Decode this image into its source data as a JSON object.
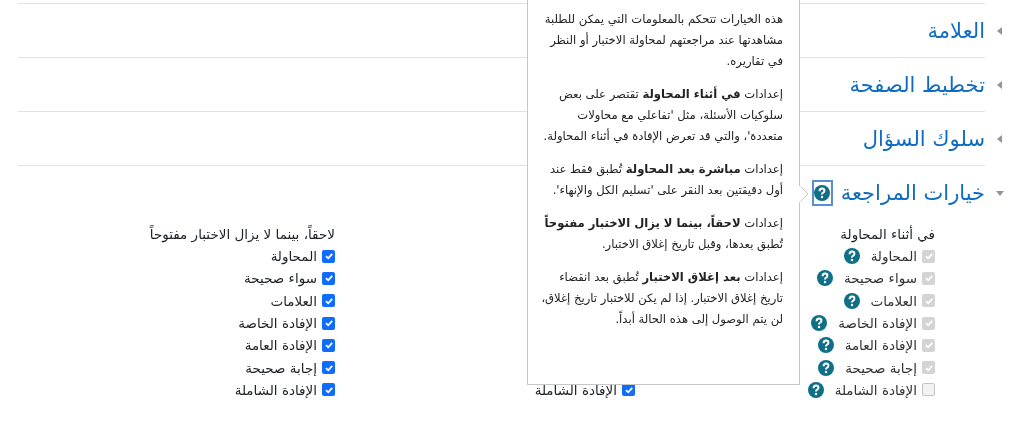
{
  "sections": [
    {
      "title": "العلامة",
      "expanded": false
    },
    {
      "title": "تخطيط الصفحة",
      "expanded": false
    },
    {
      "title": "سلوك السؤال",
      "expanded": false
    },
    {
      "title": "خيارات المراجعة",
      "expanded": true
    }
  ],
  "review_columns": [
    {
      "heading": "في أثناء المحاولة",
      "items": [
        {
          "label": "المحاولة",
          "checked": true,
          "disabled": true,
          "help": true
        },
        {
          "label": "سواء صحيحة",
          "checked": true,
          "disabled": true,
          "help": true
        },
        {
          "label": "العلامات",
          "checked": true,
          "disabled": true,
          "help": true
        },
        {
          "label": "الإفادة الخاصة",
          "checked": true,
          "disabled": true,
          "help": true
        },
        {
          "label": "الإفادة العامة",
          "checked": true,
          "disabled": true,
          "help": true
        },
        {
          "label": "إجابة صحيحة",
          "checked": true,
          "disabled": true,
          "help": true
        },
        {
          "label": "الإفادة الشاملة",
          "checked": false,
          "disabled": true,
          "help": true
        }
      ]
    },
    {
      "items": [
        {
          "label": "الإفادة الشاملة",
          "checked": true,
          "disabled": false,
          "help": false
        }
      ]
    },
    {
      "heading": "لاحقاً، بينما لا يزال الاختبار مفتوحاً",
      "items": [
        {
          "label": "المحاولة",
          "checked": true,
          "disabled": false,
          "help": false
        },
        {
          "label": "سواء صحيحة",
          "checked": true,
          "disabled": false,
          "help": false
        },
        {
          "label": "العلامات",
          "checked": true,
          "disabled": false,
          "help": false
        },
        {
          "label": "الإفادة الخاصة",
          "checked": true,
          "disabled": false,
          "help": false
        },
        {
          "label": "الإفادة العامة",
          "checked": true,
          "disabled": false,
          "help": false
        },
        {
          "label": "إجابة صحيحة",
          "checked": true,
          "disabled": false,
          "help": false
        },
        {
          "label": "الإفادة الشاملة",
          "checked": true,
          "disabled": false,
          "help": false
        }
      ]
    }
  ],
  "help_popover": {
    "paragraphs": [
      "هذه الخيارات تتحكم بالمعلومات التي يمكن للطلبة مشاهدتها عند مراجعتهم لمحاولة الاختبار أو النظر في تقاريره.",
      "إعدادات **في أثناء المحاولة** تقتصر على بعض سلوكيات الأسئلة، مثل 'تفاعلي مع محاولات متعددة'، والتي قد تعرض الإفادة في أثناء المحاولة.",
      "إعدادات **مباشرة بعد المحاولة** تُطبق فقط عند أول دقيقتين بعد النقر على 'تسليم الكل والإنهاء'.",
      "إعدادات **لاحقاً، بينما لا يزال الاختبار مفتوحاً** تُطبق بعدها، وقبل تاريخ إغلاق الاختبار.",
      "إعدادات **بعد إغلاق الاختبار** تُطبق بعد انقضاء تاريخ إغلاق الاختبار. إذا لم يكن للاختبار تاريخ إغلاق، لن يتم الوصول إلى هذه الحالة أبداً."
    ]
  }
}
